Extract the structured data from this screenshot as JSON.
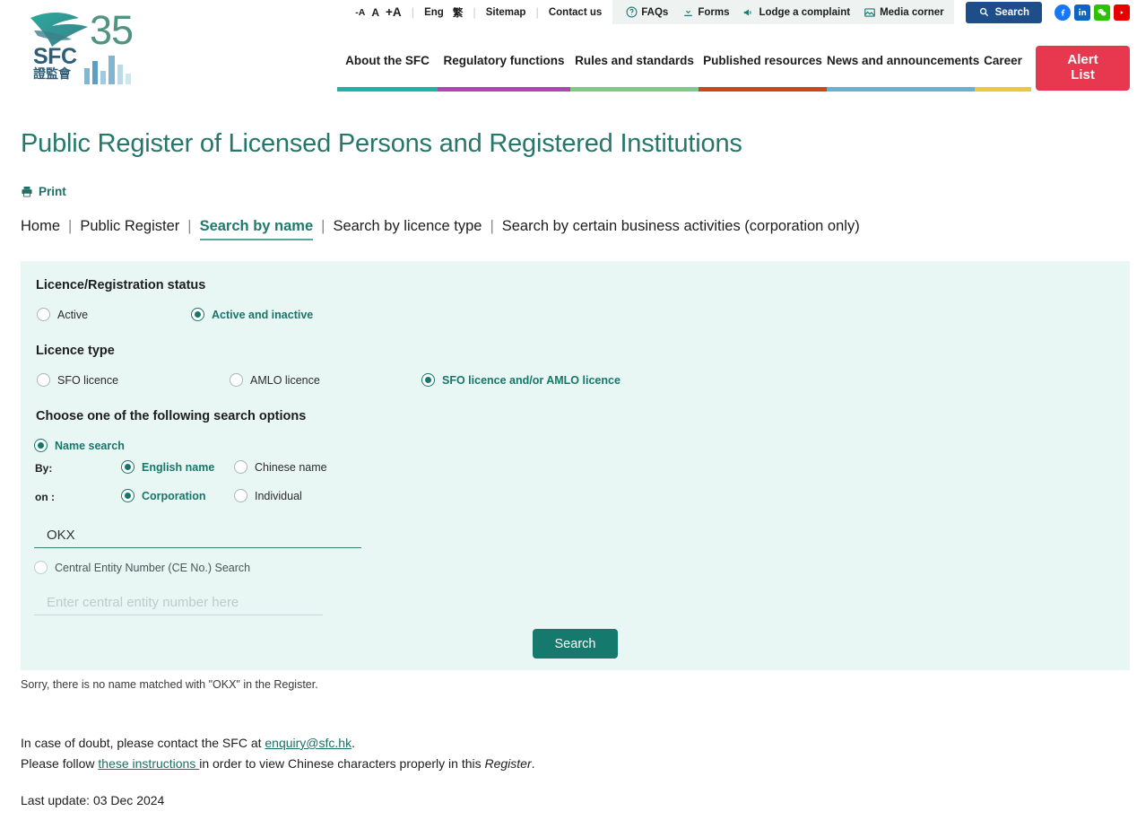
{
  "utility": {
    "font_size": {
      "decrease": "-A",
      "normal": "A",
      "increase": "+A"
    },
    "lang_en": "Eng",
    "lang_zh": "繁",
    "sitemap": "Sitemap",
    "contact": "Contact us",
    "faqs": "FAQs",
    "forms": "Forms",
    "complaint": "Lodge a complaint",
    "media": "Media corner",
    "search_button": "Search",
    "social": [
      {
        "name": "facebook-icon",
        "color": "#1877f2"
      },
      {
        "name": "linkedin-icon",
        "color": "#0a66c2"
      },
      {
        "name": "wechat-icon",
        "color": "#2dc100"
      },
      {
        "name": "youtube-icon",
        "color": "#e60000"
      }
    ]
  },
  "logo": {
    "abbr": "SFC",
    "chinese": "證監會",
    "anniversary": "35"
  },
  "nav": {
    "items": [
      {
        "label": "About the SFC",
        "color": "#21b2a6",
        "width": 112
      },
      {
        "label": "Regulatory functions",
        "color": "#b344b7",
        "width": 148
      },
      {
        "label": "Rules and standards",
        "color": "#7ccb8b",
        "width": 143
      },
      {
        "label": "Published resources",
        "color": "#d1451b",
        "width": 143
      },
      {
        "label": "News and announcements",
        "color": "#69aed6",
        "width": 165
      },
      {
        "label": "Career",
        "color": "#f0c442",
        "width": 63
      }
    ],
    "alert_list": "Alert\nList",
    "alert_list_line1": "Alert",
    "alert_list_line2": "List"
  },
  "page": {
    "title": "Public Register of Licensed Persons and Registered Institutions",
    "print": "Print"
  },
  "crumbs": [
    {
      "label": "Home",
      "active": false
    },
    {
      "label": "Public Register",
      "active": false
    },
    {
      "label": "Search by name",
      "active": true
    },
    {
      "label": "Search by licence type",
      "active": false
    },
    {
      "label": "Search by certain business activities (corporation only)",
      "active": false
    }
  ],
  "form": {
    "status_title": "Licence/Registration status",
    "status_options": [
      {
        "label": "Active",
        "selected": false
      },
      {
        "label": "Active and inactive",
        "selected": true
      }
    ],
    "type_title": "Licence type",
    "type_options": [
      {
        "label": "SFO licence",
        "selected": false
      },
      {
        "label": "AMLO licence",
        "selected": false
      },
      {
        "label": "SFO licence and/or AMLO licence",
        "selected": true
      }
    ],
    "options_title": "Choose one of the following search options",
    "name_search": {
      "label": "Name search",
      "selected": true
    },
    "by_label": "By:",
    "by_options": [
      {
        "label": "English name",
        "selected": true
      },
      {
        "label": "Chinese name",
        "selected": false
      }
    ],
    "on_label": "on :",
    "on_options": [
      {
        "label": "Corporation",
        "selected": true
      },
      {
        "label": "Individual",
        "selected": false
      }
    ],
    "name_value": "OKX",
    "name_placeholder": "",
    "ce_search": {
      "label": "Central Entity Number (CE No.) Search",
      "selected": false
    },
    "ce_value": "",
    "ce_placeholder": "Enter central entity number here",
    "submit": "Search"
  },
  "result": {
    "message": "Sorry, there is no name matched with \"OKX\" in the Register."
  },
  "footer": {
    "doubt_prefix": "In case of doubt, please contact the SFC at ",
    "email": "enquiry@sfc.hk",
    "doubt_suffix": ".",
    "instructions_prefix": "Please follow ",
    "instructions_link": "these instructions ",
    "instructions_mid": "in order to view Chinese characters properly in this ",
    "instructions_italic": "Register",
    "instructions_suffix": ".",
    "last_update": "Last update: 03 Dec 2024"
  },
  "colors": {
    "brand_teal": "#16796d",
    "panel_bg": "#e8f7f4",
    "alert_red": "#e8384f",
    "search_blue": "#1d4e89"
  }
}
